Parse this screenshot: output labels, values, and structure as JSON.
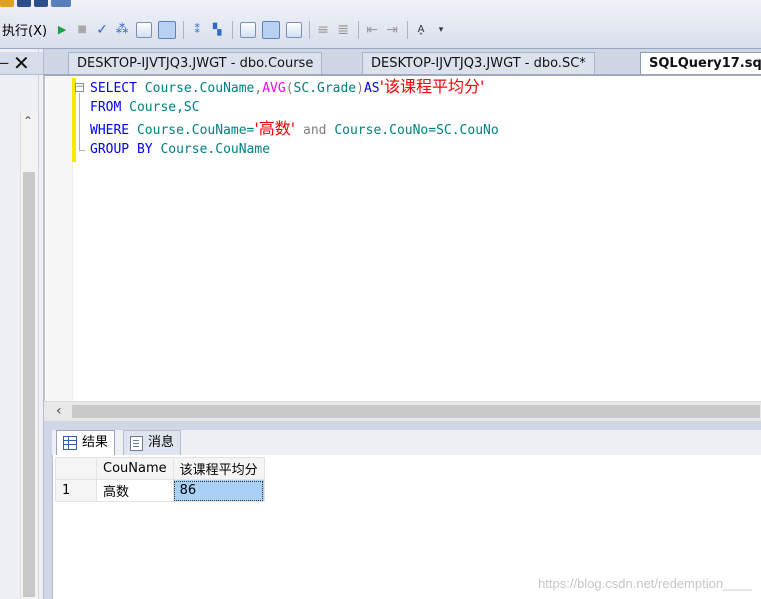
{
  "toolbar": {
    "execute_label": "执行(X)"
  },
  "tabs": [
    {
      "label": "DESKTOP-IJVTJQ3.JWGT - dbo.Course"
    },
    {
      "label": "DESKTOP-IJVTJQ3.JWGT - dbo.SC*"
    },
    {
      "label": "SQLQuery17.sq"
    }
  ],
  "editor": {
    "lines": [
      {
        "kw1": "SELECT",
        "id1": "Course.CouName",
        "fn": "AVG",
        "op1": "(",
        "id2": "SC.Grade",
        "op2": ")",
        "kw2": "AS",
        "str": "'该课程平均分'"
      },
      {
        "kw1": "FROM",
        "id1": "Course,SC"
      },
      {
        "kw1": "WHERE",
        "id1": "Course.CouName=",
        "str": "'高数'",
        "op1": "and",
        "id2": "Course.CouNo=SC.CouNo"
      },
      {
        "kw1": "GROUP BY",
        "id1": "Course.CouName"
      }
    ]
  },
  "results": {
    "tabs": [
      {
        "label": "结果"
      },
      {
        "label": "消息"
      }
    ],
    "columns": [
      "CouName",
      "该课程平均分"
    ],
    "rows": [
      {
        "num": "1",
        "cells": [
          "高数",
          "86"
        ]
      }
    ]
  },
  "watermark": "https://blog.csdn.net/redemption____"
}
